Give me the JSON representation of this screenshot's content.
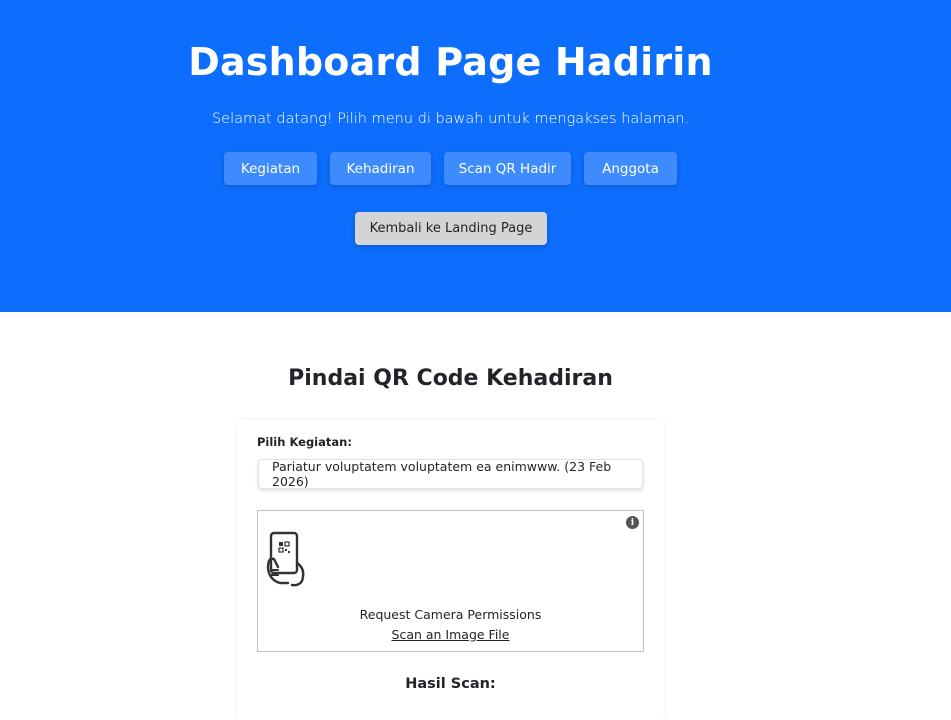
{
  "header": {
    "title": "Dashboard Page Hadirin",
    "subtitle": "Selamat datang! Pilih menu di bawah untuk mengakses halaman.",
    "nav": [
      {
        "label": "Kegiatan"
      },
      {
        "label": "Kehadiran"
      },
      {
        "label": "Scan QR Hadir"
      },
      {
        "label": "Anggota"
      }
    ],
    "back_label": "Kembali ke Landing Page",
    "background_color": "#0d6efd"
  },
  "main": {
    "title": "Pindai QR Code Kehadiran",
    "select": {
      "label": "Pilih Kegiatan:",
      "value": "Pariatur voluptatem voluptatem ea enimwww. (23 Feb 2026)"
    },
    "scanner": {
      "info_icon": "info-icon",
      "camera_icon": "phone-qr-icon",
      "request_camera_label": "Request Camera Permissions",
      "scan_file_label": "Scan an Image File"
    },
    "result_title": "Hasil Scan:"
  }
}
